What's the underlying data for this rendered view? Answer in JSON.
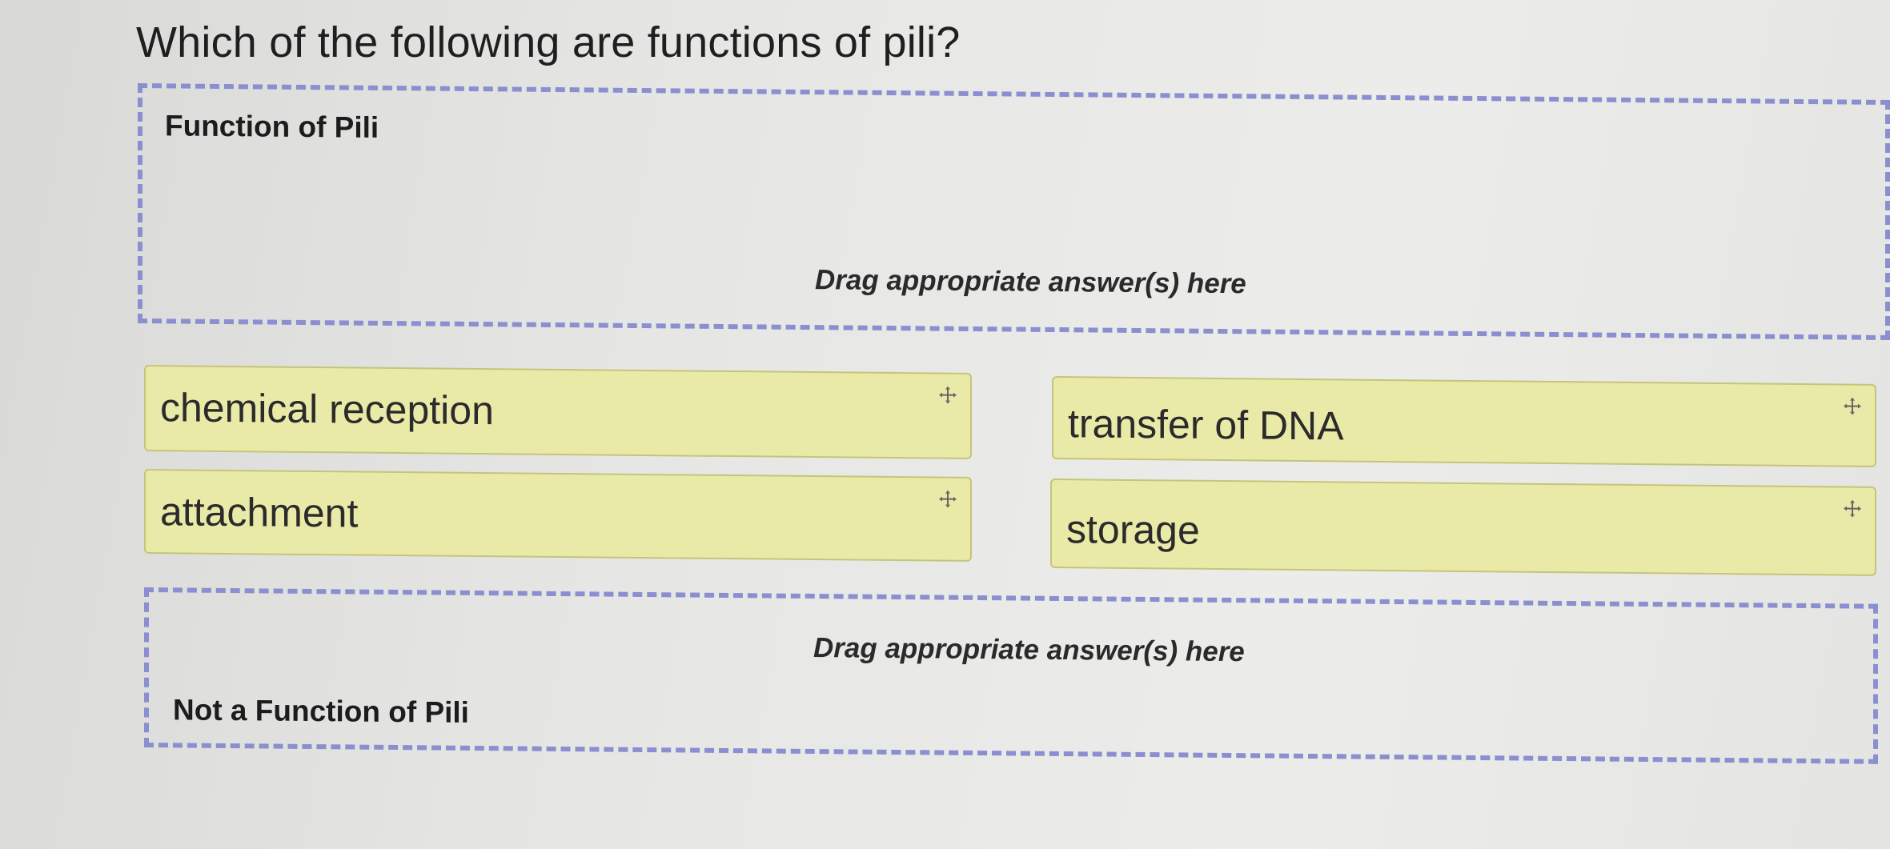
{
  "question": "Which of the following are functions of pili?",
  "zones": {
    "top": {
      "title": "Function of Pili",
      "hint": "Drag appropriate answer(s) here"
    },
    "bottom": {
      "title": "Not a Function of Pili",
      "hint": "Drag appropriate answer(s) here"
    }
  },
  "answers": [
    {
      "label": "chemical reception"
    },
    {
      "label": "transfer of DNA"
    },
    {
      "label": "attachment"
    },
    {
      "label": "storage"
    }
  ],
  "colors": {
    "card_background": "#eaeaa8",
    "card_border": "#c5c57a",
    "dropzone_border": "#8a8fd0"
  },
  "icons": {
    "drag_handle": "move-arrows-icon"
  }
}
